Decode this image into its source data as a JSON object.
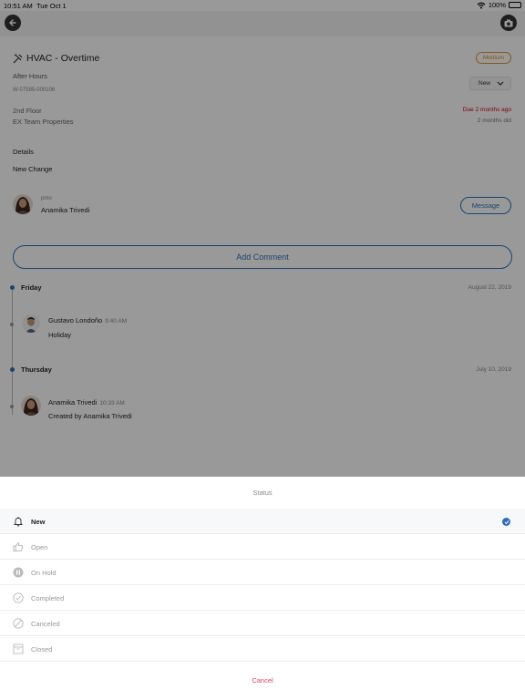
{
  "statusbar": {
    "time": "10:51 AM",
    "date": "Tue Oct 1",
    "battery": "100%"
  },
  "work_order": {
    "title": "HVAC - Overtime",
    "priority": "Medium",
    "subtitle": "After Hours",
    "id": "W-07585-000106",
    "status": "New",
    "location_line1": "2nd Floor",
    "location_line2": "EX Team Properties",
    "due": "Due 2 months ago",
    "age": "2 months old",
    "details_heading": "Details",
    "details_value": "New Change"
  },
  "contact": {
    "role": "pmo",
    "name": "Anamika Trivedi",
    "message_label": "Message"
  },
  "add_comment_label": "Add Comment",
  "timeline": [
    {
      "day": "Friday",
      "date": "August 22, 2019",
      "user": "Gustavo Londoño",
      "time": "9:40 AM",
      "text": "Holiday"
    },
    {
      "day": "Thursday",
      "date": "July 10, 2019",
      "user": "Anamika Trivedi",
      "time": "10:33 AM",
      "text": "Created by Anamika Trivedi"
    }
  ],
  "status_sheet": {
    "title": "Status",
    "options": [
      {
        "label": "New",
        "icon": "bell-icon",
        "selected": true
      },
      {
        "label": "Open",
        "icon": "thumbs-up-icon",
        "selected": false
      },
      {
        "label": "On Hold",
        "icon": "pause-icon",
        "selected": false
      },
      {
        "label": "Completed",
        "icon": "check-circle-icon",
        "selected": false
      },
      {
        "label": "Canceled",
        "icon": "cancel-icon",
        "selected": false
      },
      {
        "label": "Closed",
        "icon": "archive-icon",
        "selected": false
      }
    ],
    "cancel_label": "Cancel"
  },
  "colors": {
    "accent": "#2f6fb8",
    "priority": "#e0912b",
    "due": "#d0021b",
    "cancel": "#e0445a"
  }
}
